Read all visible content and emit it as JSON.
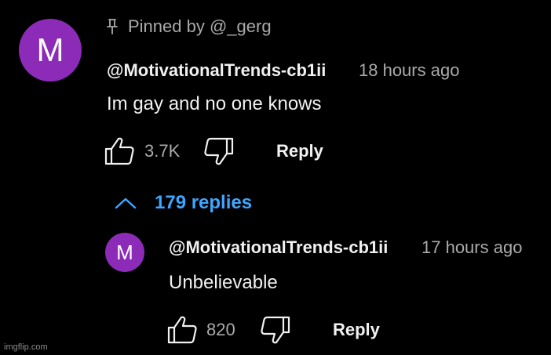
{
  "colors": {
    "background": "#000000",
    "text_primary": "#f1f1f1",
    "text_secondary": "#aaaaaa",
    "link_blue": "#3ea6ff",
    "avatar_purple": "#8c2bb8"
  },
  "main_comment": {
    "avatar_letter": "M",
    "pinned_label": "Pinned by @_gerg",
    "pin_icon": "pin-icon",
    "author": "@MotivationalTrends-cb1ii",
    "time": "18 hours ago",
    "text": "Im gay and no one knows",
    "like_count": "3.7K",
    "reply_label": "Reply"
  },
  "replies_toggle": {
    "label": "179 replies",
    "icon": "chevron-up-icon"
  },
  "reply_comment": {
    "avatar_letter": "M",
    "author": "@MotivationalTrends-cb1ii",
    "time": "17 hours ago",
    "text": "Unbelievable",
    "like_count": "820",
    "reply_label": "Reply"
  },
  "watermark": "imgflip.com"
}
